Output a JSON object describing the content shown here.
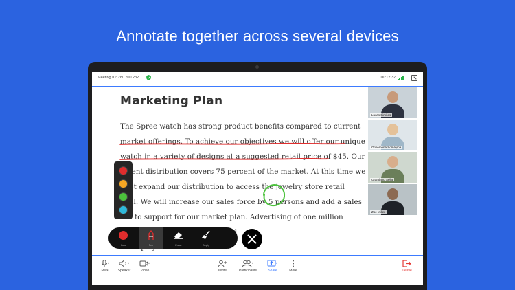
{
  "headline": "Annotate together across several devices",
  "meeting": {
    "id_text": "Meeting ID: 280 700 232",
    "timer": "00:12:32"
  },
  "document": {
    "title": "Marketing Plan",
    "lines": [
      "The Spree watch has strong product benefits compared to current",
      "market offerings. To achieve our objectives we will offer our unique",
      "watch in a variety of designs at a suggested retail price of $45. Our",
      "urrent distribution covers 75 percent of the market. At this time we",
      "l not expand our distribution to access the jewelry store retail",
      "nnel. We will increase our sales force by 5 persons and add a sales",
      "ner to support for our market plan. Advertising of one million",
      "                         esign           the watch and is weighted",
      "                         se displays. This and television"
    ]
  },
  "participants": [
    {
      "name": "Lucas Simões"
    },
    {
      "name": "Gosemena Somayina"
    },
    {
      "name": "Grantland Sella"
    },
    {
      "name": "Zoe Miller"
    }
  ],
  "palette": {
    "colors": [
      "#e02d2d",
      "#f5a623",
      "#4cc23c",
      "#2fb8d9"
    ]
  },
  "annotation_tools": [
    {
      "id": "color",
      "label": "Color"
    },
    {
      "id": "pen",
      "label": "Pen"
    },
    {
      "id": "eraser",
      "label": "Erase"
    },
    {
      "id": "clear",
      "label": "Empty"
    }
  ],
  "controls": [
    {
      "id": "mute",
      "label": "Mute"
    },
    {
      "id": "speaker",
      "label": "Speaker"
    },
    {
      "id": "video",
      "label": "Video"
    },
    {
      "id": "invite",
      "label": "Invite"
    },
    {
      "id": "participants",
      "label": "Participants"
    },
    {
      "id": "share",
      "label": "Share"
    },
    {
      "id": "more",
      "label": "More"
    },
    {
      "id": "leave",
      "label": "Leave"
    }
  ],
  "colors": {
    "background": "#2b63e0",
    "accent": "#3d7bff",
    "annotation_red": "#e02d2d",
    "annotation_green": "#4cc23c",
    "leave": "#e53935"
  }
}
